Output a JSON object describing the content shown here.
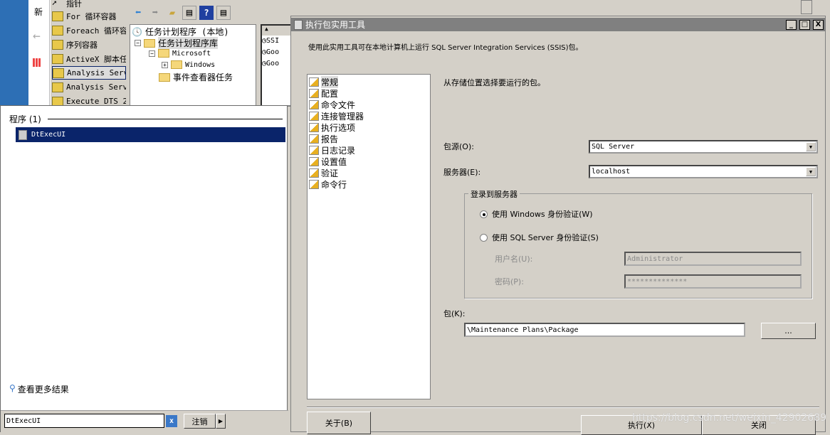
{
  "browser": {
    "tab_label": "新"
  },
  "toolbox": {
    "items": [
      {
        "label": "指针"
      },
      {
        "label": "For 循环容器"
      },
      {
        "label": "Foreach 循环容"
      },
      {
        "label": "序列容器"
      },
      {
        "label": "ActiveX 脚本任"
      },
      {
        "label": "Analysis Serv",
        "selected": true
      },
      {
        "label": "Analysis Serv"
      },
      {
        "label": "Execute DTS 2"
      }
    ]
  },
  "mmc": {
    "tree": {
      "root": "任务计划程序 (本地)",
      "library": "任务计划程序库",
      "microsoft": "Microsoft",
      "windows": "Windows",
      "event_viewer": "事件查看器任务"
    },
    "list": [
      "SSI",
      "Goo",
      "Goo"
    ]
  },
  "startmenu": {
    "section_header": "程序 (1)",
    "result": "DtExecUI",
    "more_results": "查看更多结果",
    "search_value": "DtExecUI",
    "logoff_label": "注销"
  },
  "dialog": {
    "title": "执行包实用工具",
    "description": "使用此实用工具可在本地计算机上运行 SQL Server Integration Services (SSIS)包。",
    "nav": [
      "常规",
      "配置",
      "命令文件",
      "连接管理器",
      "执行选项",
      "报告",
      "日志记录",
      "设置值",
      "验证",
      "命令行"
    ],
    "nav_selected": 0,
    "instruction": "从存储位置选择要运行的包。",
    "package_source_label": "包源(O):",
    "package_source_value": "SQL Server",
    "server_label": "服务器(E):",
    "server_value": "localhost",
    "login_group": "登录到服务器",
    "auth_windows": "使用 Windows 身份验证(W)",
    "auth_sql": "使用 SQL Server 身份验证(S)",
    "auth_selected": "windows",
    "username_label": "用户名(U):",
    "username_value": "Administrator",
    "password_label": "密码(P):",
    "password_value": "**************",
    "package_label": "包(K):",
    "package_value": "\\Maintenance Plans\\Package",
    "browse_label": "...",
    "about_label": "关于(B)",
    "execute_label": "执行(X)",
    "close_label": "关闭"
  },
  "watermark": "https://blog.csdn.net/weixin_42902689"
}
